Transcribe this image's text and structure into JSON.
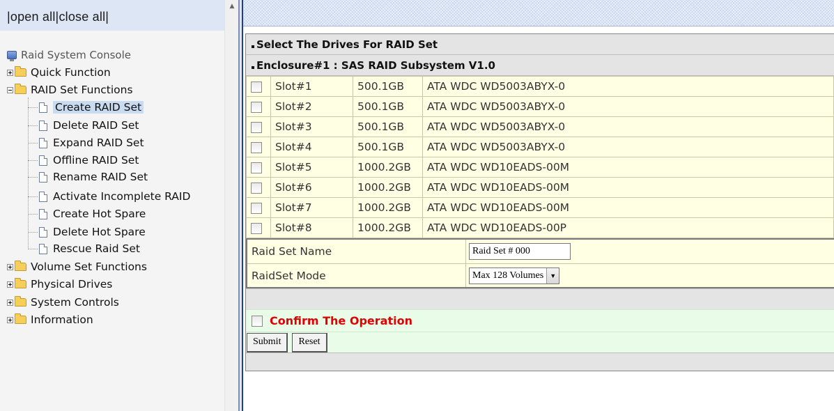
{
  "nav": {
    "open_all": "open all",
    "close_all": "close all",
    "separator": "|",
    "root": "Raid System Console",
    "items": [
      {
        "label": "Quick Function",
        "expanded": false
      },
      {
        "label": "RAID Set Functions",
        "expanded": true,
        "children": [
          "Create RAID Set",
          "Delete RAID Set",
          "Expand RAID Set",
          "Offline RAID Set",
          "Rename RAID Set",
          "Activate Incomplete RAID",
          "Create Hot Spare",
          "Delete Hot Spare",
          "Rescue Raid Set"
        ],
        "selected_child": "Create RAID Set"
      },
      {
        "label": "Volume Set Functions",
        "expanded": false
      },
      {
        "label": "Physical Drives",
        "expanded": false
      },
      {
        "label": "System Controls",
        "expanded": false
      },
      {
        "label": "Information",
        "expanded": false
      }
    ]
  },
  "content": {
    "section_title": "Select The Drives For RAID Set",
    "enclosure_title": "Enclosure#1 : SAS RAID Subsystem V1.0",
    "drives": [
      {
        "slot": "Slot#1",
        "capacity": "500.1GB",
        "model": "ATA WDC WD5003ABYX-0",
        "checked": false
      },
      {
        "slot": "Slot#2",
        "capacity": "500.1GB",
        "model": "ATA WDC WD5003ABYX-0",
        "checked": false
      },
      {
        "slot": "Slot#3",
        "capacity": "500.1GB",
        "model": "ATA WDC WD5003ABYX-0",
        "checked": false
      },
      {
        "slot": "Slot#4",
        "capacity": "500.1GB",
        "model": "ATA WDC WD5003ABYX-0",
        "checked": false
      },
      {
        "slot": "Slot#5",
        "capacity": "1000.2GB",
        "model": "ATA WDC WD10EADS-00M",
        "checked": false
      },
      {
        "slot": "Slot#6",
        "capacity": "1000.2GB",
        "model": "ATA WDC WD10EADS-00M",
        "checked": false
      },
      {
        "slot": "Slot#7",
        "capacity": "1000.2GB",
        "model": "ATA WDC WD10EADS-00M",
        "checked": false
      },
      {
        "slot": "Slot#8",
        "capacity": "1000.2GB",
        "model": "ATA WDC WD10EADS-00P",
        "checked": false
      }
    ],
    "raid_set_name_label": "Raid Set Name",
    "raid_set_name_value": "Raid Set # 000",
    "raidset_mode_label": "RaidSet Mode",
    "raidset_mode_value": "Max 128 Volumes",
    "confirm_label": "Confirm The Operation",
    "submit_label": "Submit",
    "reset_label": "Reset"
  },
  "colors": {
    "confirm_text": "#e00000",
    "row_bg": "#ffffe3",
    "confirm_bg": "#e8fce8",
    "header_bg": "#e4e4e4",
    "nav_selected_bg": "#c9dbf1"
  },
  "icons": [
    "computer-icon",
    "folder-icon",
    "document-icon",
    "tree-expand-icon",
    "tree-collapse-icon",
    "scroll-up-arrow-icon",
    "dropdown-arrow-icon"
  ]
}
